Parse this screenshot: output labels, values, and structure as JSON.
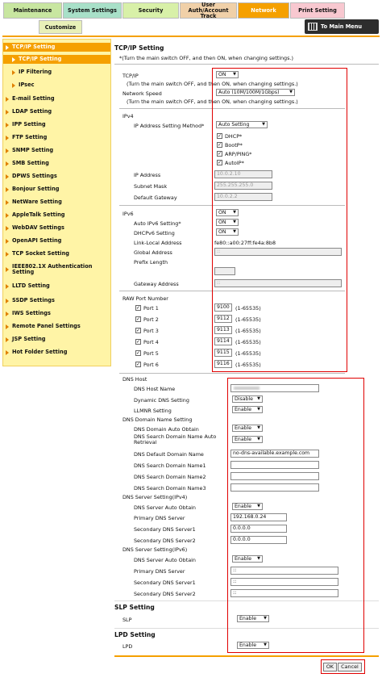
{
  "tabs": {
    "maintenance": "Maintenance",
    "system_settings": "System Settings",
    "security": "Security",
    "user_auth": "User Auth/Account Track",
    "network": "Network",
    "print_setting": "Print Setting",
    "customize": "Customize",
    "main_menu": "To Main Menu"
  },
  "sidebar": {
    "items": [
      {
        "label": "TCP/IP Setting"
      },
      {
        "label": "TCP/IP Setting"
      },
      {
        "label": "IP Filtering"
      },
      {
        "label": "IPsec"
      },
      {
        "label": "E-mail Setting"
      },
      {
        "label": "LDAP Setting"
      },
      {
        "label": "IPP Setting"
      },
      {
        "label": "FTP Setting"
      },
      {
        "label": "SNMP Setting"
      },
      {
        "label": "SMB Setting"
      },
      {
        "label": "DPWS Settings"
      },
      {
        "label": "Bonjour Setting"
      },
      {
        "label": "NetWare Setting"
      },
      {
        "label": "AppleTalk Setting"
      },
      {
        "label": "WebDAV Settings"
      },
      {
        "label": "OpenAPI Setting"
      },
      {
        "label": "TCP Socket Setting"
      },
      {
        "label": "IEEE802.1X Authentication Setting"
      },
      {
        "label": "LLTD Setting"
      },
      {
        "label": "SSDP Settings"
      },
      {
        "label": "IWS Settings"
      },
      {
        "label": "Remote Panel Settings"
      },
      {
        "label": "JSP Setting"
      },
      {
        "label": "Hot Folder Setting"
      }
    ]
  },
  "main": {
    "title": "TCP/IP Setting",
    "note": "*(Turn the main switch OFF, and then ON, when changing settings.)",
    "tcpip_label": "TCP/IP",
    "tcpip_value": "ON",
    "tcpip_note": "(Turn the main switch OFF, and then ON, when changing settings.)",
    "speed_label": "Network Speed",
    "speed_value": "Auto (10M/100M/1Gbps)",
    "speed_note": "(Turn the main switch OFF, and then ON, when changing settings.)",
    "ipv4": {
      "heading": "IPv4",
      "method_label": "IP Address Setting Method*",
      "method_value": "Auto Setting",
      "dhcp": "DHCP*",
      "bootp": "BootP*",
      "arp": "ARP/PING*",
      "autoip": "AutoIP*",
      "ip_label": "IP Address",
      "ip_value": "10.0.2.10",
      "mask_label": "Subnet Mask",
      "mask_value": "255.255.255.0",
      "gw_label": "Default Gateway",
      "gw_value": "10.0.2.2"
    },
    "ipv6": {
      "heading": "IPv6",
      "value": "ON",
      "auto_label": "Auto IPv6 Setting*",
      "auto_value": "ON",
      "dhcp_label": "DHCPv6 Setting",
      "dhcp_value": "ON",
      "link_label": "Link-Local Address",
      "link_value": "fe80::a00:27ff:fe4a:8b8",
      "global_label": "Global Address",
      "global_value": "::",
      "prefix_label": "Prefix Length",
      "gw_label": "Gateway Address",
      "gw_value": "::"
    },
    "raw": {
      "heading": "RAW Port Number",
      "ports": [
        {
          "label": "Port 1",
          "value": "9100",
          "range": "(1-65535)"
        },
        {
          "label": "Port 2",
          "value": "9112",
          "range": "(1-65535)"
        },
        {
          "label": "Port 3",
          "value": "9113",
          "range": "(1-65535)"
        },
        {
          "label": "Port 4",
          "value": "9114",
          "range": "(1-65535)"
        },
        {
          "label": "Port 5",
          "value": "9115",
          "range": "(1-65535)"
        },
        {
          "label": "Port 6",
          "value": "9116",
          "range": "(1-65535)"
        }
      ]
    },
    "dns": {
      "host_heading": "DNS Host",
      "host_name_label": "DNS Host Name",
      "dynamic_label": "Dynamic DNS Setting",
      "dynamic_value": "Disable",
      "llmnr_label": "LLMNR Setting",
      "llmnr_value": "Enable",
      "domain_heading": "DNS Domain Name Setting",
      "domain_auto_label": "DNS Domain Auto Obtain",
      "domain_auto_value": "Enable",
      "search_auto_label": "DNS Search Domain Name Auto Retrieval",
      "search_auto_value": "Enable",
      "default_domain_label": "DNS Default Domain Name",
      "default_domain_value": "no-dns-available.example.com",
      "search1_label": "DNS Search Domain Name1",
      "search2_label": "DNS Search Domain Name2",
      "search3_label": "DNS Search Domain Name3",
      "server4_heading": "DNS Server Setting(IPv4)",
      "server4_auto_label": "DNS Server Auto Obtain",
      "server4_auto_value": "Enable",
      "primary4_label": "Primary DNS Server",
      "primary4_value": "192.168.0.24",
      "secondary4_1_label": "Secondary DNS Server1",
      "secondary4_1_value": "0.0.0.0",
      "secondary4_2_label": "Secondary DNS Server2",
      "secondary4_2_value": "0.0.0.0",
      "server6_heading": "DNS Server Setting(IPv6)",
      "server6_auto_label": "DNS Server Auto Obtain",
      "server6_auto_value": "Enable",
      "primary6_label": "Primary DNS Server",
      "primary6_value": "::",
      "secondary6_1_label": "Secondary DNS Server1",
      "secondary6_1_value": "::",
      "secondary6_2_label": "Secondary DNS Server2",
      "secondary6_2_value": "::"
    },
    "slp": {
      "heading": "SLP Setting",
      "label": "SLP",
      "value": "Enable"
    },
    "lpd": {
      "heading": "LPD Setting",
      "label": "LPD",
      "value": "Enable"
    },
    "ok": "OK",
    "cancel": "Cancel"
  },
  "colors": {
    "accent": "#f5a000",
    "highlight_box": "#e00000",
    "sidebar_bg": "#fff4a6"
  }
}
